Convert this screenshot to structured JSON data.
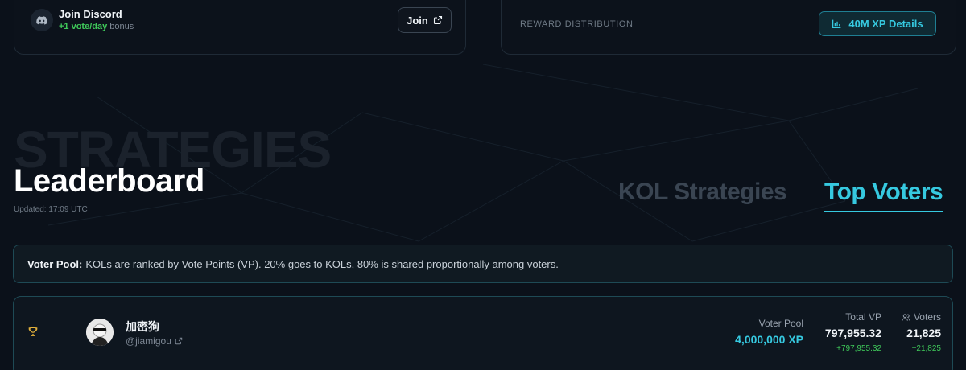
{
  "discord_card": {
    "title": "Join Discord",
    "bonus_highlight": "+1 vote/day",
    "bonus_suffix": "bonus",
    "join_label": "Join"
  },
  "reward_card": {
    "label": "REWARD DISTRIBUTION",
    "button_label": "40M XP Details"
  },
  "header": {
    "background_word": "STRATEGIES",
    "title": "Leaderboard",
    "updated": "Updated: 17:09 UTC"
  },
  "tabs": [
    {
      "label": "KOL Strategies",
      "active": false
    },
    {
      "label": "Top Voters",
      "active": true
    }
  ],
  "banner": {
    "label": "Voter Pool:",
    "text": "KOLs are ranked by Vote Points (VP). 20% goes to KOLs, 80% is shared proportionally among voters."
  },
  "leaderboard": {
    "rows": [
      {
        "rank_icon": "trophy-icon",
        "name": "加密狗",
        "handle": "@jiamigou",
        "voter_pool_label": "Voter Pool",
        "voter_pool_value": "4,000,000 XP",
        "total_vp_label": "Total VP",
        "total_vp_value": "797,955.32",
        "total_vp_delta": "+797,955.32",
        "voters_label": "Voters",
        "voters_value": "21,825",
        "voters_delta": "+21,825"
      }
    ]
  },
  "colors": {
    "accent": "#36c9e0",
    "positive": "#3fc85a",
    "background": "#0b111a"
  }
}
